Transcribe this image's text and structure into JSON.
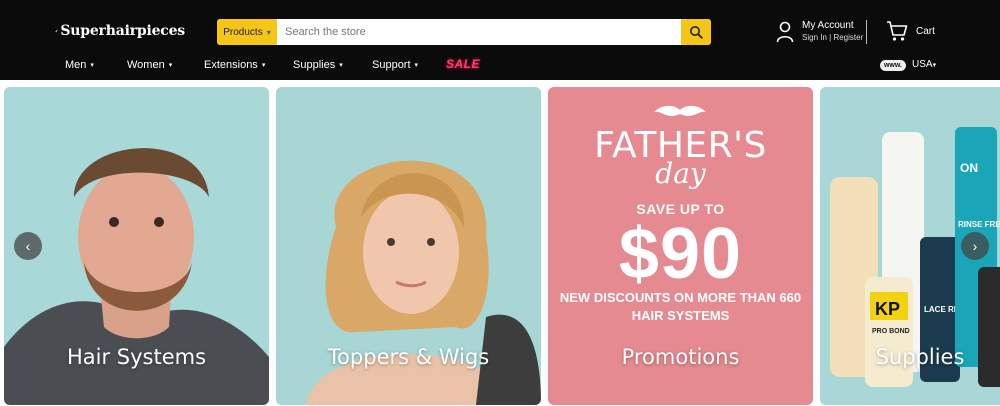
{
  "brand": {
    "name": "Superhairpieces"
  },
  "search": {
    "category": "Products",
    "placeholder": "Search the store"
  },
  "account": {
    "title": "My Account",
    "sign_in": "Sign In",
    "separator": "|",
    "register": "Register"
  },
  "cart": {
    "label": "Cart"
  },
  "nav": {
    "items": [
      {
        "label": "Men"
      },
      {
        "label": "Women"
      },
      {
        "label": "Extensions"
      },
      {
        "label": "Supplies"
      },
      {
        "label": "Support"
      }
    ],
    "sale": "SALE",
    "lang_badge": "www.",
    "region": "USA"
  },
  "carousel": {
    "cards": [
      {
        "label": "Hair Systems"
      },
      {
        "label": "Toppers & Wigs"
      },
      {
        "label": "Promotions",
        "promo_title": "FATHER'S",
        "promo_script": "day",
        "promo_save": "SAVE UP TO",
        "promo_amount": "$90",
        "promo_note": "NEW DISCOUNTS ON MORE THAN 660 HAIR SYSTEMS"
      },
      {
        "label": "Supplies",
        "bottle_texts": [
          "ON",
          "RINSE FREE",
          "KP",
          "PRO BOND",
          "LACE RELEASE"
        ]
      }
    ]
  },
  "colors": {
    "header_bg": "#0b0b0b",
    "accent": "#f5c518",
    "sale": "#ff3a6e",
    "promo_bg": "#e58a90",
    "card_bg": "#a9d8d8"
  },
  "icons": {
    "search": "search-icon",
    "account": "user-icon",
    "cart": "cart-icon",
    "prev": "chevron-left-icon",
    "next": "chevron-right-icon"
  }
}
